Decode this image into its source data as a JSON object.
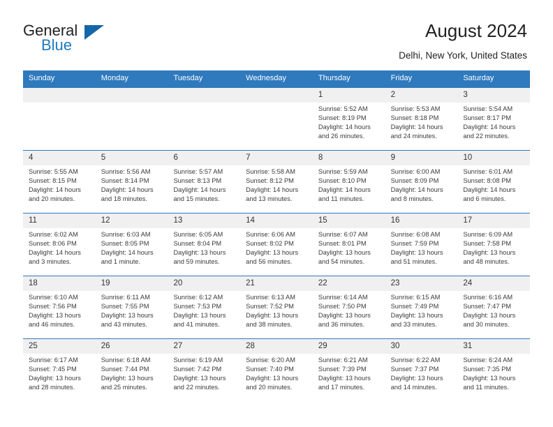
{
  "brand": {
    "name_part1": "General",
    "name_part2": "Blue",
    "triangle_color": "#1566a8",
    "accent_color": "#1f7ac0"
  },
  "header": {
    "title": "August 2024",
    "subtitle": "Delhi, New York, United States"
  },
  "calendar": {
    "header_bg": "#2f79bd",
    "daynum_bg": "#f0f0f0",
    "weekdays": [
      "Sunday",
      "Monday",
      "Tuesday",
      "Wednesday",
      "Thursday",
      "Friday",
      "Saturday"
    ],
    "weeks": [
      [
        {
          "blank": true
        },
        {
          "blank": true
        },
        {
          "blank": true
        },
        {
          "blank": true
        },
        {
          "day": "1",
          "sunrise": "Sunrise: 5:52 AM",
          "sunset": "Sunset: 8:19 PM",
          "daylight1": "Daylight: 14 hours",
          "daylight2": "and 26 minutes."
        },
        {
          "day": "2",
          "sunrise": "Sunrise: 5:53 AM",
          "sunset": "Sunset: 8:18 PM",
          "daylight1": "Daylight: 14 hours",
          "daylight2": "and 24 minutes."
        },
        {
          "day": "3",
          "sunrise": "Sunrise: 5:54 AM",
          "sunset": "Sunset: 8:17 PM",
          "daylight1": "Daylight: 14 hours",
          "daylight2": "and 22 minutes."
        }
      ],
      [
        {
          "day": "4",
          "sunrise": "Sunrise: 5:55 AM",
          "sunset": "Sunset: 8:15 PM",
          "daylight1": "Daylight: 14 hours",
          "daylight2": "and 20 minutes."
        },
        {
          "day": "5",
          "sunrise": "Sunrise: 5:56 AM",
          "sunset": "Sunset: 8:14 PM",
          "daylight1": "Daylight: 14 hours",
          "daylight2": "and 18 minutes."
        },
        {
          "day": "6",
          "sunrise": "Sunrise: 5:57 AM",
          "sunset": "Sunset: 8:13 PM",
          "daylight1": "Daylight: 14 hours",
          "daylight2": "and 15 minutes."
        },
        {
          "day": "7",
          "sunrise": "Sunrise: 5:58 AM",
          "sunset": "Sunset: 8:12 PM",
          "daylight1": "Daylight: 14 hours",
          "daylight2": "and 13 minutes."
        },
        {
          "day": "8",
          "sunrise": "Sunrise: 5:59 AM",
          "sunset": "Sunset: 8:10 PM",
          "daylight1": "Daylight: 14 hours",
          "daylight2": "and 11 minutes."
        },
        {
          "day": "9",
          "sunrise": "Sunrise: 6:00 AM",
          "sunset": "Sunset: 8:09 PM",
          "daylight1": "Daylight: 14 hours",
          "daylight2": "and 8 minutes."
        },
        {
          "day": "10",
          "sunrise": "Sunrise: 6:01 AM",
          "sunset": "Sunset: 8:08 PM",
          "daylight1": "Daylight: 14 hours",
          "daylight2": "and 6 minutes."
        }
      ],
      [
        {
          "day": "11",
          "sunrise": "Sunrise: 6:02 AM",
          "sunset": "Sunset: 8:06 PM",
          "daylight1": "Daylight: 14 hours",
          "daylight2": "and 3 minutes."
        },
        {
          "day": "12",
          "sunrise": "Sunrise: 6:03 AM",
          "sunset": "Sunset: 8:05 PM",
          "daylight1": "Daylight: 14 hours",
          "daylight2": "and 1 minute."
        },
        {
          "day": "13",
          "sunrise": "Sunrise: 6:05 AM",
          "sunset": "Sunset: 8:04 PM",
          "daylight1": "Daylight: 13 hours",
          "daylight2": "and 59 minutes."
        },
        {
          "day": "14",
          "sunrise": "Sunrise: 6:06 AM",
          "sunset": "Sunset: 8:02 PM",
          "daylight1": "Daylight: 13 hours",
          "daylight2": "and 56 minutes."
        },
        {
          "day": "15",
          "sunrise": "Sunrise: 6:07 AM",
          "sunset": "Sunset: 8:01 PM",
          "daylight1": "Daylight: 13 hours",
          "daylight2": "and 54 minutes."
        },
        {
          "day": "16",
          "sunrise": "Sunrise: 6:08 AM",
          "sunset": "Sunset: 7:59 PM",
          "daylight1": "Daylight: 13 hours",
          "daylight2": "and 51 minutes."
        },
        {
          "day": "17",
          "sunrise": "Sunrise: 6:09 AM",
          "sunset": "Sunset: 7:58 PM",
          "daylight1": "Daylight: 13 hours",
          "daylight2": "and 48 minutes."
        }
      ],
      [
        {
          "day": "18",
          "sunrise": "Sunrise: 6:10 AM",
          "sunset": "Sunset: 7:56 PM",
          "daylight1": "Daylight: 13 hours",
          "daylight2": "and 46 minutes."
        },
        {
          "day": "19",
          "sunrise": "Sunrise: 6:11 AM",
          "sunset": "Sunset: 7:55 PM",
          "daylight1": "Daylight: 13 hours",
          "daylight2": "and 43 minutes."
        },
        {
          "day": "20",
          "sunrise": "Sunrise: 6:12 AM",
          "sunset": "Sunset: 7:53 PM",
          "daylight1": "Daylight: 13 hours",
          "daylight2": "and 41 minutes."
        },
        {
          "day": "21",
          "sunrise": "Sunrise: 6:13 AM",
          "sunset": "Sunset: 7:52 PM",
          "daylight1": "Daylight: 13 hours",
          "daylight2": "and 38 minutes."
        },
        {
          "day": "22",
          "sunrise": "Sunrise: 6:14 AM",
          "sunset": "Sunset: 7:50 PM",
          "daylight1": "Daylight: 13 hours",
          "daylight2": "and 36 minutes."
        },
        {
          "day": "23",
          "sunrise": "Sunrise: 6:15 AM",
          "sunset": "Sunset: 7:49 PM",
          "daylight1": "Daylight: 13 hours",
          "daylight2": "and 33 minutes."
        },
        {
          "day": "24",
          "sunrise": "Sunrise: 6:16 AM",
          "sunset": "Sunset: 7:47 PM",
          "daylight1": "Daylight: 13 hours",
          "daylight2": "and 30 minutes."
        }
      ],
      [
        {
          "day": "25",
          "sunrise": "Sunrise: 6:17 AM",
          "sunset": "Sunset: 7:45 PM",
          "daylight1": "Daylight: 13 hours",
          "daylight2": "and 28 minutes."
        },
        {
          "day": "26",
          "sunrise": "Sunrise: 6:18 AM",
          "sunset": "Sunset: 7:44 PM",
          "daylight1": "Daylight: 13 hours",
          "daylight2": "and 25 minutes."
        },
        {
          "day": "27",
          "sunrise": "Sunrise: 6:19 AM",
          "sunset": "Sunset: 7:42 PM",
          "daylight1": "Daylight: 13 hours",
          "daylight2": "and 22 minutes."
        },
        {
          "day": "28",
          "sunrise": "Sunrise: 6:20 AM",
          "sunset": "Sunset: 7:40 PM",
          "daylight1": "Daylight: 13 hours",
          "daylight2": "and 20 minutes."
        },
        {
          "day": "29",
          "sunrise": "Sunrise: 6:21 AM",
          "sunset": "Sunset: 7:39 PM",
          "daylight1": "Daylight: 13 hours",
          "daylight2": "and 17 minutes."
        },
        {
          "day": "30",
          "sunrise": "Sunrise: 6:22 AM",
          "sunset": "Sunset: 7:37 PM",
          "daylight1": "Daylight: 13 hours",
          "daylight2": "and 14 minutes."
        },
        {
          "day": "31",
          "sunrise": "Sunrise: 6:24 AM",
          "sunset": "Sunset: 7:35 PM",
          "daylight1": "Daylight: 13 hours",
          "daylight2": "and 11 minutes."
        }
      ]
    ]
  }
}
